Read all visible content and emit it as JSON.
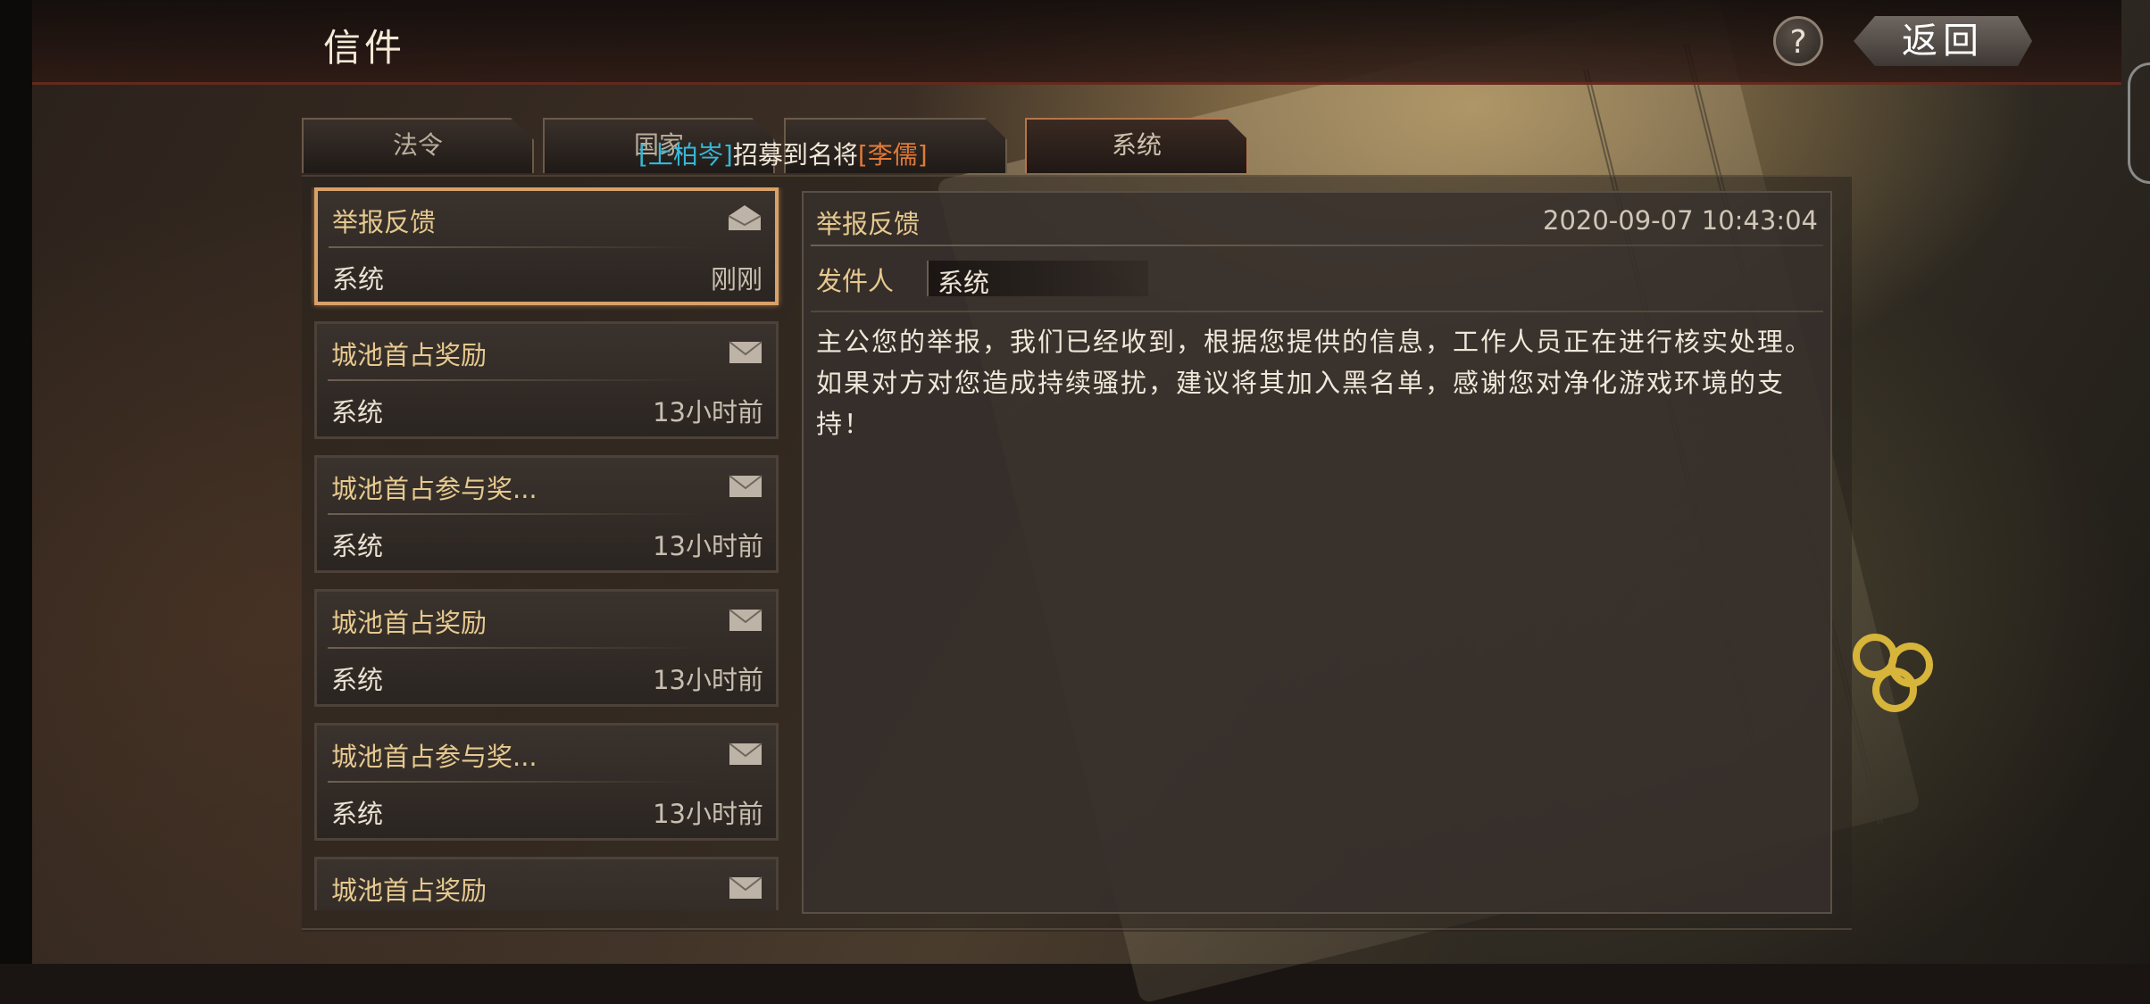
{
  "header": {
    "title": "信件",
    "help_label": "?",
    "back_label": "返回"
  },
  "tabs": [
    {
      "label": "法令",
      "active": false
    },
    {
      "label": "国家",
      "active": false
    },
    {
      "label": "",
      "active": false
    },
    {
      "label": "系统",
      "active": true
    }
  ],
  "ticker": {
    "player": "[上柏岑]",
    "middle": "招募到名将",
    "hero": "[李儒]"
  },
  "mails": [
    {
      "title": "举报反馈",
      "sender": "系统",
      "time": "刚刚",
      "selected": true,
      "icon": "envelope-open-icon"
    },
    {
      "title": "城池首占奖励",
      "sender": "系统",
      "time": "13小时前",
      "icon": "envelope-icon"
    },
    {
      "title": "城池首占参与奖...",
      "sender": "系统",
      "time": "13小时前",
      "icon": "envelope-icon"
    },
    {
      "title": "城池首占奖励",
      "sender": "系统",
      "time": "13小时前",
      "icon": "envelope-icon"
    },
    {
      "title": "城池首占参与奖...",
      "sender": "系统",
      "time": "13小时前",
      "icon": "envelope-icon"
    },
    {
      "title": "城池首占奖励",
      "sender": "",
      "time": "",
      "icon": "envelope-icon"
    }
  ],
  "detail": {
    "subject": "举报反馈",
    "date": "2020-09-07 10:43:04",
    "sender_label": "发件人",
    "sender": "系统",
    "body": "主公您的举报，我们已经收到，根据您提供的信息，工作人员正在进行核实处理。如果对方对您造成持续骚扰，建议将其加入黑名单，感谢您对净化游戏环境的支持！"
  }
}
